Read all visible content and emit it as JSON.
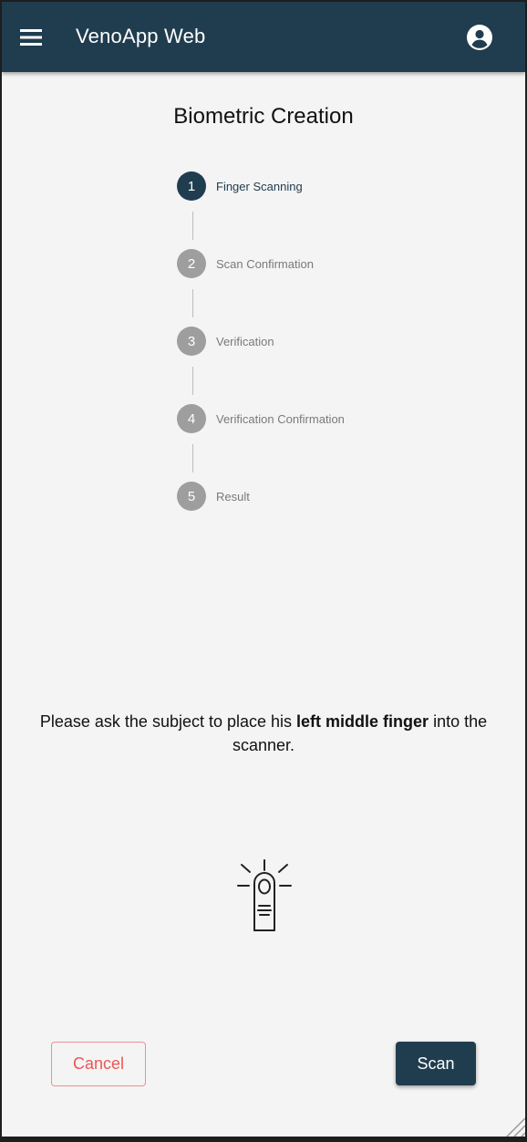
{
  "header": {
    "app_title": "VenoApp Web",
    "menu_icon": "hamburger-menu-icon",
    "account_icon": "account-circle-icon"
  },
  "page": {
    "title": "Biometric Creation"
  },
  "stepper": {
    "steps": [
      {
        "number": "1",
        "label": "Finger Scanning",
        "active": true
      },
      {
        "number": "2",
        "label": "Scan Confirmation",
        "active": false
      },
      {
        "number": "3",
        "label": "Verification",
        "active": false
      },
      {
        "number": "4",
        "label": "Verification Confirmation",
        "active": false
      },
      {
        "number": "5",
        "label": "Result",
        "active": false
      }
    ]
  },
  "instruction": {
    "prefix": "Please ask the subject to place his ",
    "emphasis": "left middle finger",
    "suffix": " into the scanner."
  },
  "illustration": {
    "icon": "finger-scan-icon"
  },
  "actions": {
    "cancel_label": "Cancel",
    "scan_label": "Scan"
  },
  "colors": {
    "primary": "#203d4f",
    "inactive_step": "#9e9e9e",
    "cancel": "#ee5555",
    "background": "#f4f4f4"
  }
}
